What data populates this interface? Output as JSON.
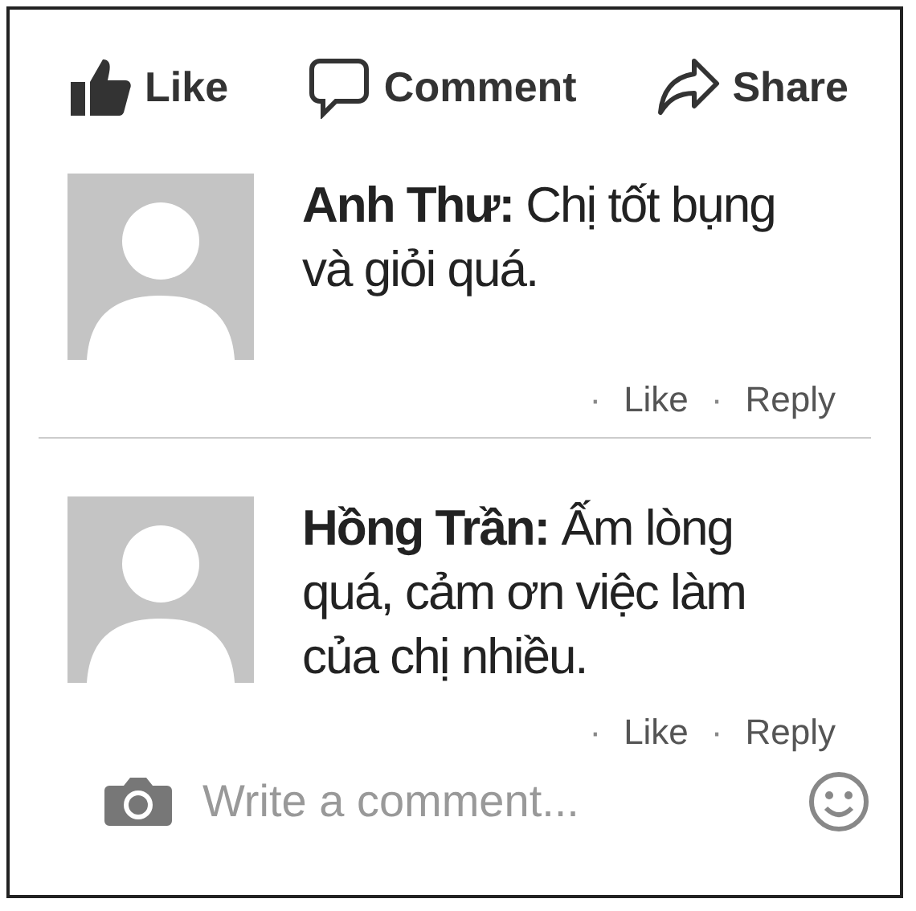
{
  "action_bar": [
    {
      "kind": "like",
      "label": "Like"
    },
    {
      "kind": "comment",
      "label": "Comment"
    },
    {
      "kind": "share",
      "label": "Share"
    }
  ],
  "comments": [
    {
      "author": "Anh Thư:",
      "text": "Chị tốt bụng và giỏi quá.",
      "actions": [
        {
          "dot": "·",
          "label": "Like"
        },
        {
          "dot": "·",
          "label": "Reply"
        }
      ]
    },
    {
      "author": "Hồng Trần:",
      "text": "Ấm lòng quá, cảm ơn việc làm của chị nhiều.",
      "actions": [
        {
          "dot": "·",
          "label": "Like"
        },
        {
          "dot": "·",
          "label": "Reply"
        }
      ]
    }
  ],
  "composer": {
    "placeholder": "Write a comment..."
  }
}
